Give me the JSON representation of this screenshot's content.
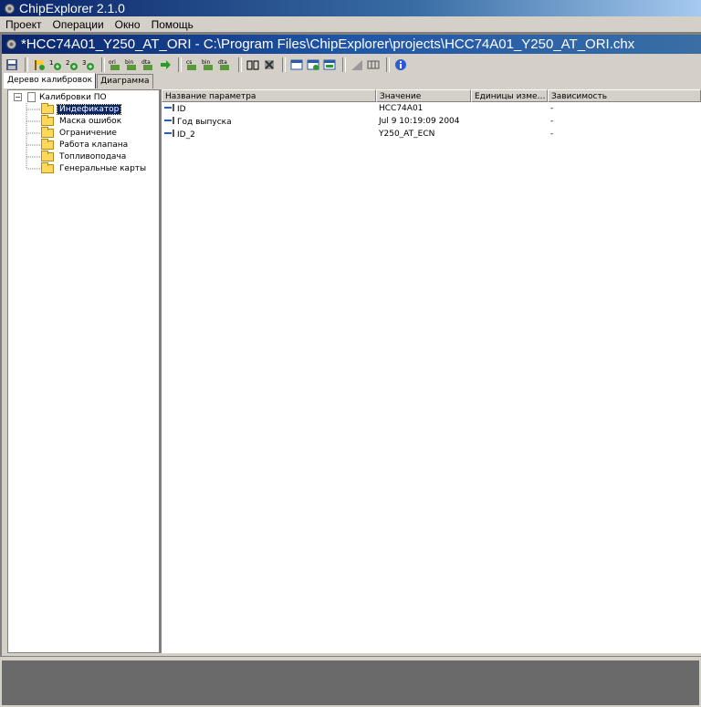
{
  "app": {
    "title": "ChipExplorer 2.1.0"
  },
  "menu": [
    "Проект",
    "Операции",
    "Окно",
    "Помощь"
  ],
  "document": {
    "title": "*HCC74A01_Y250_AT_ORI - C:\\Program Files\\ChipExplorer\\projects\\HCC74A01_Y250_AT_ORI.chx"
  },
  "toolbar": {
    "buttons": [
      "save-icon",
      "flag-add-icon",
      "add-1-icon",
      "add-2-icon",
      "add-3-icon",
      "ori-icon",
      "bin-icon",
      "dta-icon",
      "arrow-right-icon",
      "cs-icon",
      "bin2-icon",
      "dta2-icon",
      "compare-icon",
      "delete-icon",
      "window1-icon",
      "window2-icon",
      "window3-icon",
      "chart-icon",
      "hex-icon",
      "info-icon"
    ]
  },
  "tabs": [
    {
      "label": "Дерево калибровок",
      "active": true
    },
    {
      "label": "Диаграмма",
      "active": false
    }
  ],
  "tree": {
    "root": "Калибровки ПО",
    "items": [
      {
        "label": "Индефикатор",
        "selected": true
      },
      {
        "label": "Маска ошибок",
        "selected": false
      },
      {
        "label": "Ограничение",
        "selected": false
      },
      {
        "label": "Работа клапана",
        "selected": false
      },
      {
        "label": "Топливоподача",
        "selected": false
      },
      {
        "label": "Генеральные карты",
        "selected": false
      }
    ]
  },
  "table": {
    "columns": [
      "Название параметра",
      "Значение",
      "Единицы изме…",
      "Зависимость"
    ],
    "rows": [
      {
        "name": "ID",
        "value": "HCC74A01",
        "units": "",
        "dependency": "-"
      },
      {
        "name": "Год выпуска",
        "value": "Jul  9 10:19:09 2004",
        "units": "",
        "dependency": "-"
      },
      {
        "name": "ID_2",
        "value": "Y250_AT_ECN",
        "units": "",
        "dependency": "-"
      }
    ]
  },
  "colors": {
    "title_bar": "#0a246a",
    "selection": "#0a246a",
    "folder": "#ffd85a",
    "window_bg": "#d4d0c8"
  }
}
